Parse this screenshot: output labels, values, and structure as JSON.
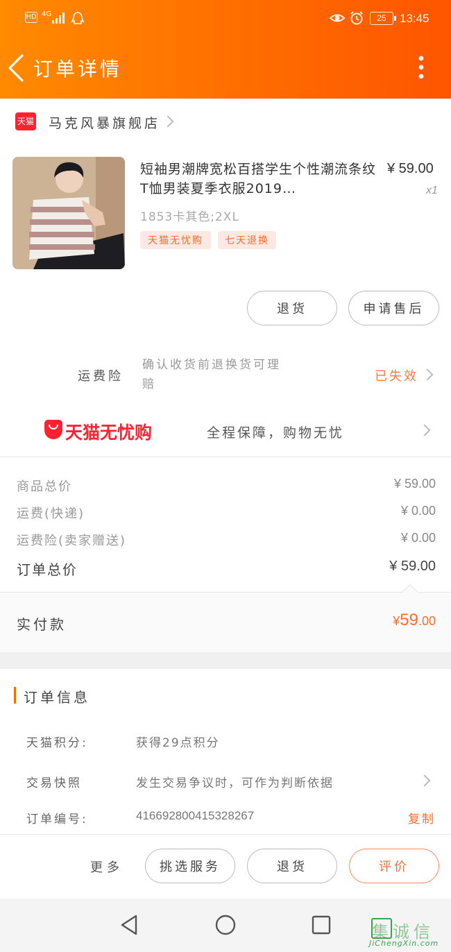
{
  "status_bar": {
    "network": "HD",
    "signal": "4G",
    "battery": "25",
    "time": "13:45"
  },
  "header": {
    "title": "订单详情"
  },
  "store": {
    "badge": "天猫",
    "name": "马克风暴旗舰店"
  },
  "product": {
    "title": "短袖男潮牌宽松百搭学生个性潮流条纹T恤男装夏季衣服2019…",
    "price": "¥ 59.00",
    "qty": "x1",
    "sku": "1853卡其色;2XL",
    "tags": [
      "天猫无忧购",
      "七天退换"
    ],
    "refund_label": "退货",
    "after_sale_label": "申请售后"
  },
  "shipping_insurance": {
    "label": "运费险",
    "desc": "确认收货前退换货可理赔",
    "status": "已失效"
  },
  "guarantee": {
    "brand": "天猫无忧购",
    "text": "全程保障，购物无忧"
  },
  "totals": {
    "items": [
      {
        "label": "商品总价",
        "value": "¥ 59.00"
      },
      {
        "label": "运费(快递)",
        "value": "¥ 0.00"
      },
      {
        "label": "运费险(卖家赠送)",
        "value": "¥ 0.00"
      }
    ],
    "order_total_label": "订单总价",
    "order_total": "¥ 59.00",
    "paid_label": "实付款",
    "paid_currency": "¥",
    "paid_int": "59",
    "paid_dec": ".00"
  },
  "order_info": {
    "section_title": "订单信息",
    "points_label": "天猫积分:",
    "points_value": "获得29点积分",
    "snapshot_label": "交易快照",
    "snapshot_value": "发生交易争议时，可作为判断依据",
    "order_no_label": "订单编号:",
    "order_no_value": "416692800415328267",
    "copy_label": "复制"
  },
  "bottom_actions": {
    "more": "更多",
    "select_service": "挑选服务",
    "refund": "退货",
    "review": "评价"
  },
  "watermark": {
    "brand": "集诚信",
    "url": "JiChengXin.com"
  },
  "colors": {
    "accent": "#ff6a00",
    "price_orange": "#ff6a2f",
    "review_border": "#ff8a5c"
  }
}
